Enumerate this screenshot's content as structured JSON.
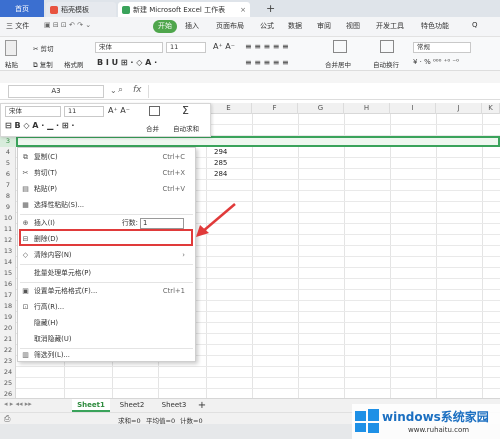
{
  "titlebar": {
    "tabs": [
      {
        "label": "首页"
      },
      {
        "label": "稻壳模板"
      },
      {
        "label": "新建 Microsoft Excel 工作表"
      }
    ],
    "new_tab": "+"
  },
  "menubar": {
    "items": [
      "三 文件",
      "开始",
      "插入",
      "页面布局",
      "公式",
      "数据",
      "审阅",
      "视图",
      "开发工具",
      "特色功能"
    ],
    "search": "Q"
  },
  "ribbon": {
    "paste": "粘贴",
    "cut": "剪切",
    "copy": "复制",
    "format_painter": "格式刷",
    "font_name": "宋体",
    "font_size": "11",
    "merge_center": "合并居中",
    "wrap": "自动换行",
    "number_format": "常规"
  },
  "formulabar": {
    "namebox": "A3",
    "fx": "fx"
  },
  "mini_toolbar": {
    "font_name": "宋体",
    "font_size": "11",
    "merge": "合并",
    "autosum": "自动求和"
  },
  "grid": {
    "columns": [
      "A",
      "B",
      "C",
      "D",
      "E",
      "F",
      "G",
      "H",
      "I",
      "J",
      "K"
    ],
    "rows": [
      "1",
      "2",
      "3",
      "4",
      "5",
      "6",
      "7",
      "8",
      "9",
      "10",
      "11",
      "12",
      "13",
      "14",
      "15",
      "16",
      "17",
      "18",
      "19",
      "20",
      "21",
      "22",
      "23",
      "24",
      "25",
      "26"
    ],
    "values": [
      "294",
      "285",
      "284"
    ]
  },
  "context_menu": {
    "items": [
      {
        "label": "复制(C)",
        "shortcut": "Ctrl+C"
      },
      {
        "label": "剪切(T)",
        "shortcut": "Ctrl+X"
      },
      {
        "label": "粘贴(P)",
        "shortcut": "Ctrl+V"
      },
      {
        "label": "选择性粘贴(S)...",
        "shortcut": ""
      },
      {
        "label": "插入(I)",
        "shortcut": ""
      },
      {
        "label": "删除(D)",
        "shortcut": ""
      },
      {
        "label": "清除内容(N)",
        "shortcut": "›"
      },
      {
        "label": "批量处理单元格(P)",
        "shortcut": ""
      },
      {
        "label": "设置单元格格式(F)...",
        "shortcut": "Ctrl+1"
      },
      {
        "label": "行高(R)...",
        "shortcut": ""
      },
      {
        "label": "隐藏(H)",
        "shortcut": ""
      },
      {
        "label": "取消隐藏(U)",
        "shortcut": ""
      },
      {
        "label": "筛选列(L)...",
        "shortcut": ""
      }
    ],
    "insert_rows_label": "行数:",
    "insert_rows_value": "1"
  },
  "sheets": {
    "tabs": [
      "Sheet1",
      "Sheet2",
      "Sheet3"
    ],
    "add": "+"
  },
  "statusbar": {
    "sum": "求和=0",
    "avg": "平均值=0",
    "count": "计数=0"
  },
  "watermark": {
    "title": "windows系统家园",
    "url": "www.ruhaitu.com"
  },
  "colors": {
    "accent_green": "#4fa64c",
    "selection_green": "#3aa35b",
    "highlight_red": "#e03a3a",
    "home_tab_blue": "#3b6fd0"
  }
}
